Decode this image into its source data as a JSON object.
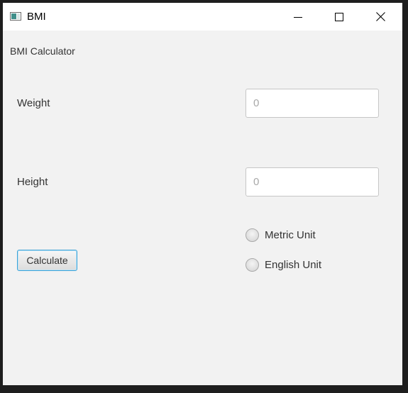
{
  "window": {
    "title": "BMI",
    "controls": {
      "minimize_icon": "minimize-icon",
      "maximize_icon": "maximize-icon",
      "close_icon": "close-icon"
    }
  },
  "main": {
    "heading": "BMI Calculator",
    "weight": {
      "label": "Weight",
      "value": "",
      "placeholder": "0"
    },
    "height": {
      "label": "Height",
      "value": "",
      "placeholder": "0"
    },
    "calculate_label": "Calculate",
    "units": [
      {
        "label": "Metric Unit",
        "selected": false
      },
      {
        "label": "English Unit",
        "selected": false
      }
    ]
  },
  "colors": {
    "window_bg": "#f2f2f2",
    "titlebar_bg": "#ffffff",
    "focus_border": "#3ba2d6"
  }
}
